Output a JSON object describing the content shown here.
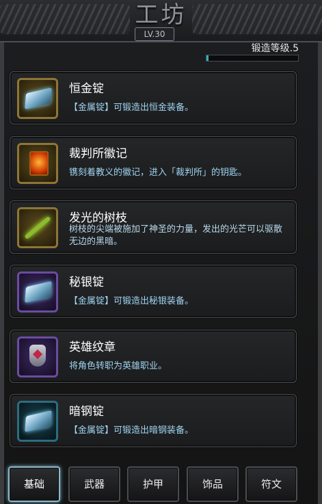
{
  "header": {
    "title": "工坊",
    "level": "LV.30"
  },
  "forge": {
    "label": "锻造等级.5",
    "progress": 0.02
  },
  "items": [
    {
      "name": "恒金锭",
      "desc": "【金属锭】可锻造出恒金装备。",
      "icon": "ingot-icon",
      "frame": "gold"
    },
    {
      "name": "裁判所徽记",
      "desc": "镌刻着教义的徽记，进入「裁判所」的钥匙。",
      "icon": "emblem-icon",
      "frame": "gold"
    },
    {
      "name": "发光的树枝",
      "desc": "树枝的尖端被施加了神圣的力量，发出的光芒可以驱散无边的黑暗。",
      "icon": "branch-icon",
      "frame": "gold"
    },
    {
      "name": "秘银锭",
      "desc": "【金属锭】可锻造出秘银装备。",
      "icon": "ingot-icon",
      "frame": "purple"
    },
    {
      "name": "英雄纹章",
      "desc": "将角色转职为英雄职业。",
      "icon": "hero-crest-icon",
      "frame": "purple"
    },
    {
      "name": "暗钢锭",
      "desc": "【金属锭】可锻造出暗钢装备。",
      "icon": "ingot-icon",
      "frame": "teal"
    }
  ],
  "tabs": [
    "基础",
    "武器",
    "护甲",
    "饰品",
    "符文"
  ],
  "colors": {
    "accent": "#2fb0c0",
    "gold_frame": "#8e7634",
    "purple_frame": "#6b4ca2",
    "teal_frame": "#2c6d80"
  }
}
